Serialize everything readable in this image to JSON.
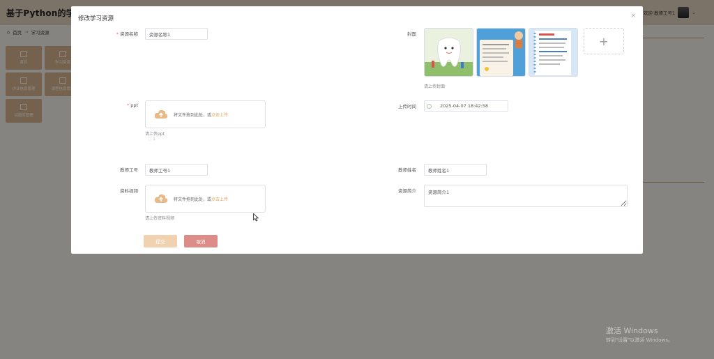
{
  "app": {
    "title": "基于Python的学生",
    "welcome": "欢迎 教师工号1",
    "breadcrumb": {
      "home": "首页",
      "sep": "→",
      "current": "学习资源"
    },
    "tiles": [
      "首页",
      "学习资源",
      "作业信息管理",
      "课程信息管理",
      "试题库管理"
    ]
  },
  "dialog": {
    "title": "修改学习资源",
    "close": "×",
    "fields": {
      "resource_name": {
        "label": "资源名称",
        "value": "资源名称1",
        "required": "*"
      },
      "cover": {
        "label": "封面",
        "tip": "请上传封面",
        "add": "+"
      },
      "ppt": {
        "label": "ppt",
        "required": "*",
        "upload_text": "将文件拖到此处，或",
        "upload_link": "点击上传",
        "tip": "请上传ppt",
        "file_name": "1"
      },
      "upload_time": {
        "label": "上传时间",
        "value": "2025-04-07 18:42:58"
      },
      "teacher_id": {
        "label": "教师工号",
        "value": "教师工号1"
      },
      "teacher_name": {
        "label": "教师姓名",
        "value": "教师姓名1"
      },
      "video": {
        "label": "资料视频",
        "upload_text": "将文件拖到此处，或",
        "upload_link": "点击上传",
        "tip": "请上传资料视频"
      },
      "intro": {
        "label": "资源简介",
        "value": "资源简介1"
      }
    },
    "buttons": {
      "submit": "提交",
      "cancel": "取消"
    },
    "cover_images": [
      {
        "name": "tooth-cartoon",
        "bg": "#e8f0dc"
      },
      {
        "name": "dental-poster",
        "bg": "#4f9fd8",
        "text": "爱牙护齿小百科"
      },
      {
        "name": "notebook-poster",
        "bg": "#cfe4f7"
      }
    ]
  },
  "watermark": {
    "line1": "激活 Windows",
    "line2": "转到\"设置\"以激活 Windows。"
  },
  "colors": {
    "accent": "#e6a15a",
    "header_bg": "#d4c7b4",
    "tile_bg": "#c9a988",
    "submit": "#f0d2b0",
    "cancel": "#dc8d87"
  }
}
